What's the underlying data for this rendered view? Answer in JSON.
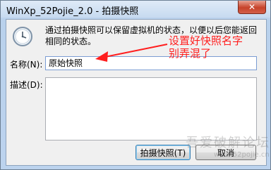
{
  "window": {
    "title": "WinXp_52Pojie_2.0 - 拍摄快照",
    "close_glyph": "✕"
  },
  "dialog": {
    "icon": "clock-icon",
    "description": "通过拍摄快照可以保留虚拟机的状态，以便以后您能返回相同的状态。",
    "name_label": "名称(N):",
    "name_value": "原始快照",
    "description_label": "描述(D):",
    "description_value": "",
    "take_snapshot_button": "拍摄快照(T)",
    "cancel_button": "取消"
  },
  "annotation": {
    "line1": "设置好快照名字",
    "line2": "别弄混了",
    "color": "#ff1e1e"
  },
  "watermark": {
    "main": "吾爱破解论坛",
    "sub": "www.52pojie.cn"
  }
}
